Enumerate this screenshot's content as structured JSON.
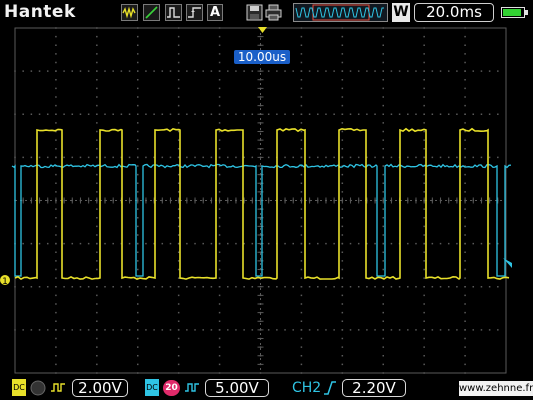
{
  "header": {
    "brand": "Hantek",
    "run_mode_label": "A",
    "timebase": "20.0ms",
    "memory_depth_label": "W",
    "battery_level": 0.9
  },
  "screen": {
    "trigger_position_label": "10.00us",
    "ch1_marker": "1",
    "colors": {
      "ch1": "#e8e02a",
      "ch2": "#2fc4e4",
      "grid": "#5a5a5a",
      "trigger": "#1a5fc8"
    }
  },
  "footer": {
    "ch1": {
      "coupling": "DC",
      "volts_per_div": "2.00V"
    },
    "ch2": {
      "coupling": "DC",
      "bw_limit_label": "20",
      "volts_per_div": "5.00V"
    },
    "trigger": {
      "source": "CH2",
      "level": "2.20V"
    },
    "website": "www.zehnne.fr"
  }
}
